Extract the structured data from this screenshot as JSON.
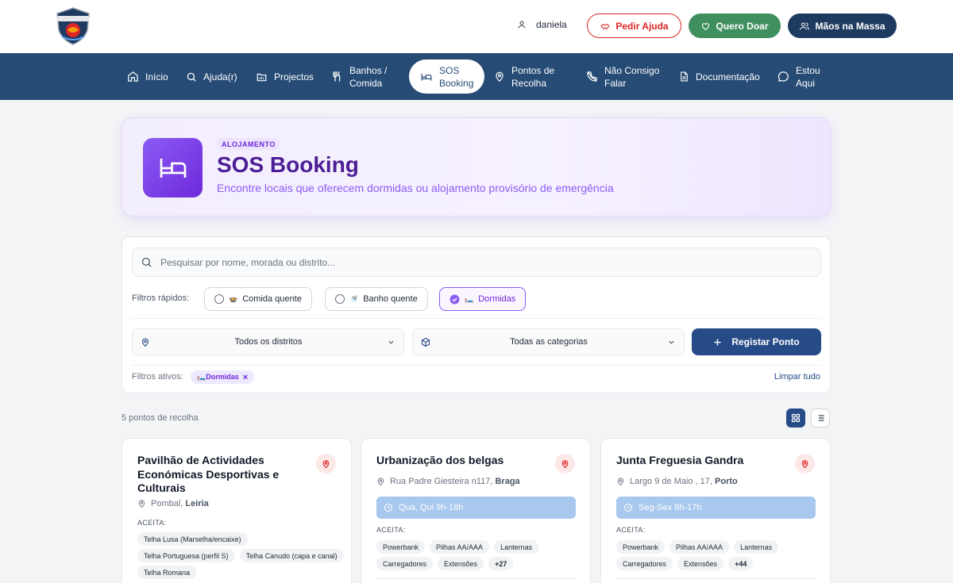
{
  "header": {
    "logo_name": "Tempestade logo",
    "user_name": "daniela",
    "buttons": {
      "ajuda": "Pedir Ajuda",
      "doar": "Quero Doar",
      "maos": "Mãos na Massa"
    },
    "colors": {
      "ajuda": "#dc2626",
      "doar": "#3f8f5f",
      "maos": "#1e3a5f"
    }
  },
  "nav": {
    "items": [
      {
        "l1": "Início",
        "l2": ""
      },
      {
        "l1": "Ajuda(r)",
        "l2": ""
      },
      {
        "l1": "Projectos",
        "l2": ""
      },
      {
        "l1": "Banhos /",
        "l2": "Comida"
      },
      {
        "l1": "SOS",
        "l2": "Booking"
      },
      {
        "l1": "Pontos de",
        "l2": "Recolha"
      },
      {
        "l1": "Não Consigo",
        "l2": "Falar"
      },
      {
        "l1": "Documentação",
        "l2": ""
      },
      {
        "l1": "Estou",
        "l2": "Aqui"
      }
    ],
    "active": "SOS Booking",
    "color": "#264b75"
  },
  "hero": {
    "badge": "ALOJAMENTO",
    "title": "SOS Booking",
    "subtitle": "Encontre locais que oferecem dormidas ou alojamento provisório de emergência"
  },
  "filters": {
    "search_placeholder": "Pesquisar por nome, morada ou distrito...",
    "quick_label": "Filtros rápidos:",
    "quick": [
      {
        "icon": "🍲",
        "label": "Comida quente",
        "checked": false
      },
      {
        "icon": "🚿",
        "label": "Banho quente",
        "checked": false
      },
      {
        "icon": "🛏️",
        "label": "Dormidas",
        "checked": true
      }
    ],
    "district": "Todos os distritos",
    "category": "Todas as categorias",
    "register": "Registar Ponto",
    "active_label": "Filtros ativos:",
    "active_tag": {
      "icon": "🛏️",
      "label": "Dormidas"
    },
    "clear": "Limpar tudo"
  },
  "results": {
    "count": "5 pontos de recolha"
  },
  "cards": [
    {
      "title": "Pavilhão de Actividades Económicas Desportivas e Culturais",
      "place": "Pombal, ",
      "district": "Leiria",
      "hours": "",
      "accepts_label": "ACEITA:",
      "tags": [
        "Telha Lusa (Marselha/encaixe)",
        "Telha Portuguesa (perfil S)",
        "Telha Canudo (capa e canal)",
        "Telha Romana"
      ],
      "more": ""
    },
    {
      "title": "Urbanização dos belgas",
      "place": "Rua Padre Giesteira n117, ",
      "district": "Braga",
      "hours": "Qua, Qui 9h-18h",
      "accepts_label": "ACEITA:",
      "tags": [
        "Powerbank",
        "Pilhas AA/AAA",
        "Lanternas",
        "Carregadores",
        "Extensões"
      ],
      "more": "+27"
    },
    {
      "title": "Junta Freguesia Gandra",
      "place": "Largo 9 de Maio , 17, ",
      "district": "Porto",
      "hours": "Seg-Sex 8h-17h",
      "accepts_label": "ACEITA:",
      "tags": [
        "Powerbank",
        "Pilhas AA/AAA",
        "Lanternas",
        "Carregadores",
        "Extensões"
      ],
      "more": "+44"
    }
  ]
}
